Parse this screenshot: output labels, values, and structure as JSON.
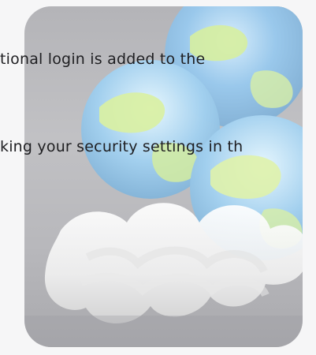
{
  "background_color": "#f3f3f4",
  "icon": {
    "name": "globe-cloud-icon",
    "colors": {
      "tile": "#bcbcc0",
      "globe_blue": "#8fc0e6",
      "globe_green": "#d9efa4",
      "cloud_white": "#f4f4f4"
    }
  },
  "text": {
    "line1": "tional login is added to the",
    "line2": "king your security settings in th"
  }
}
